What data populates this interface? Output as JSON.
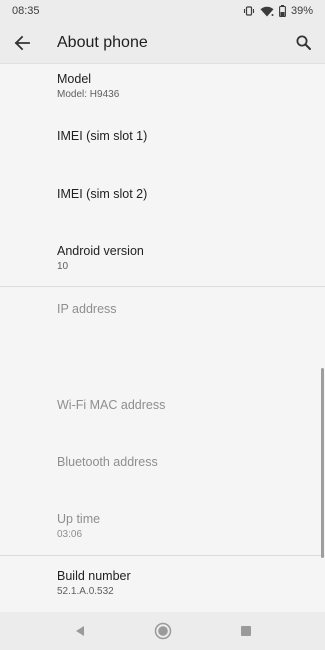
{
  "status_bar": {
    "time": "08:35",
    "battery": "39%",
    "icons": [
      "vibrate-icon",
      "wifi-icon",
      "battery-icon"
    ]
  },
  "app_bar": {
    "title": "About phone",
    "back_icon": "arrow-back-icon",
    "search_icon": "search-icon"
  },
  "items": [
    {
      "title": "Model",
      "subtitle": "Model: H9436"
    },
    {
      "title": "IMEI (sim slot 1)",
      "subtitle": ""
    },
    {
      "title": "IMEI (sim slot 2)",
      "subtitle": ""
    },
    {
      "title": "Android version",
      "subtitle": "10"
    },
    {
      "title": "IP address",
      "subtitle": ""
    },
    {
      "title": "Wi-Fi MAC address",
      "subtitle": ""
    },
    {
      "title": "Bluetooth address",
      "subtitle": ""
    },
    {
      "title": "Up time",
      "subtitle": "03:06"
    },
    {
      "title": "Build number",
      "subtitle": "52.1.A.0.532"
    }
  ],
  "nav_bar": {
    "buttons": [
      "back-triangle-icon",
      "home-circle-icon",
      "recents-square-icon"
    ]
  }
}
